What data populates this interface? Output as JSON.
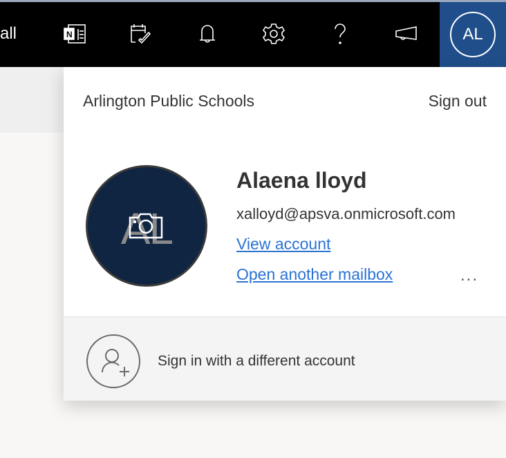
{
  "topbar": {
    "partial_text": "all",
    "icons": [
      "onenote-icon",
      "calendar-check-icon",
      "bell-icon",
      "gear-icon",
      "help-icon",
      "megaphone-icon"
    ],
    "avatar_initials": "AL",
    "avatar_bg": "#1f4e8a"
  },
  "account": {
    "organization": "Arlington Public Schools",
    "sign_out": "Sign out",
    "name": "Alaena lloyd",
    "email": "xalloyd@apsva.onmicrosoft.com",
    "initials": "AL",
    "view_account": "View account",
    "open_mailbox": "Open another mailbox",
    "more": "...",
    "link_color": "#2a72d4"
  },
  "footer": {
    "sign_in_other": "Sign in with a different account"
  }
}
